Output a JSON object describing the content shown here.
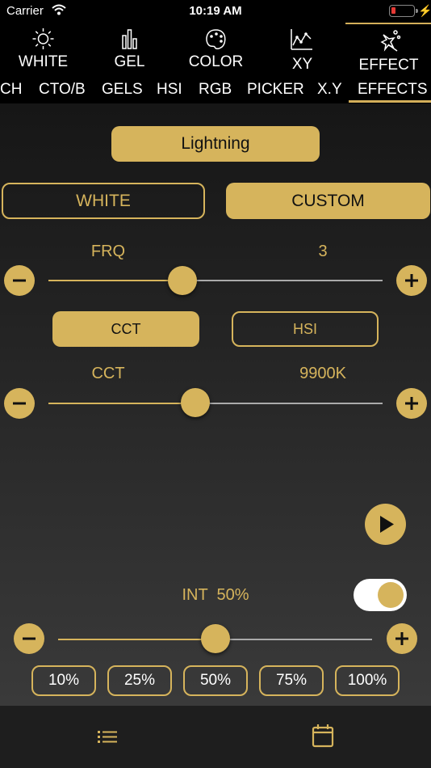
{
  "status": {
    "carrier": "Carrier",
    "time": "10:19 AM"
  },
  "modes": [
    {
      "label": "WHITE",
      "icon": "sun-icon"
    },
    {
      "label": "GEL",
      "icon": "bar-chart-icon"
    },
    {
      "label": "COLOR",
      "icon": "palette-icon"
    },
    {
      "label": "XY",
      "icon": "xy-graph-icon"
    },
    {
      "label": "EFFECT",
      "icon": "magic-wand-icon"
    }
  ],
  "subtabs": [
    "CH",
    "CTO/B",
    "GELS",
    "HSI",
    "RGB",
    "PICKER",
    "X.Y",
    "EFFECTS"
  ],
  "active_subtab": "EFFECTS",
  "effect_selector": "Lightning",
  "source_toggle": {
    "white": "WHITE",
    "custom": "CUSTOM",
    "selected": "CUSTOM"
  },
  "frq": {
    "label": "FRQ",
    "value": "3",
    "level": 0.4
  },
  "color_mode": {
    "cct": "CCT",
    "hsi": "HSI",
    "selected": "CCT"
  },
  "cct": {
    "label": "CCT",
    "value": "9900K",
    "level": 0.44
  },
  "intensity": {
    "label": "INT  50%",
    "level": 0.5,
    "enabled": true
  },
  "presets": [
    "10%",
    "25%",
    "50%",
    "75%",
    "100%"
  ],
  "colors": {
    "accent": "#d6b45c",
    "background": "#000000"
  }
}
